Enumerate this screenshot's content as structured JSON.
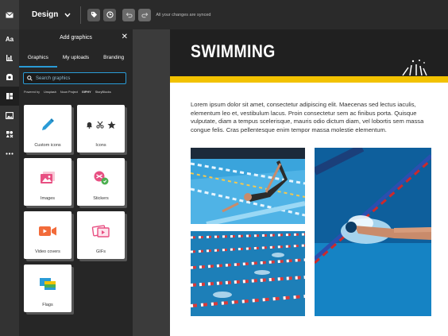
{
  "topbar": {
    "design_label": "Design",
    "synced_text": "All your changes are synced",
    "logo_icon": "envelope-icon",
    "tag_icon": "tag-icon",
    "history_icon": "clock-icon",
    "undo_icon": "undo-icon",
    "redo_icon": "redo-icon"
  },
  "rail": {
    "text_label": "Aa",
    "items": [
      "text-icon",
      "chart-icon",
      "media-icon",
      "layout-icon",
      "image-icon",
      "shapes-icon",
      "more-icon"
    ]
  },
  "panel": {
    "title": "Add graphics",
    "close": "✕",
    "tabs": [
      "Graphics",
      "My uploads",
      "Branding"
    ],
    "search_placeholder": "Search graphics",
    "powered_by": "Powered by",
    "providers": [
      "Unsplash",
      "Noun Project",
      "GIPHY",
      "StoryBlocks"
    ],
    "cards": [
      {
        "label": "Custom icons"
      },
      {
        "label": "Icons"
      },
      {
        "label": "Images"
      },
      {
        "label": "Stickers"
      },
      {
        "label": "Video covers"
      },
      {
        "label": "GIFs"
      },
      {
        "label": "Flags"
      }
    ]
  },
  "document": {
    "title": "SWIMMING",
    "body": "Lorem ipsum dolor sit amet, consectetur adipiscing elit. Maecenas sed lectus iaculis, elementum leo et, vestibulum lacus. Proin consectetur sem ac finibus porta. Quisque vulputate, diam a tempus scelerisque, mauris odio dictum diam, vel lobortis sem massa congue felis. Cras pellentesque enim tempor massa molestie elementum.",
    "accent_color": "#f2c200",
    "header_color": "#202020"
  },
  "colors": {
    "accent_blue": "#2a9bd6",
    "panel_bg": "#262626",
    "topbar_bg": "#2a2a2a"
  }
}
